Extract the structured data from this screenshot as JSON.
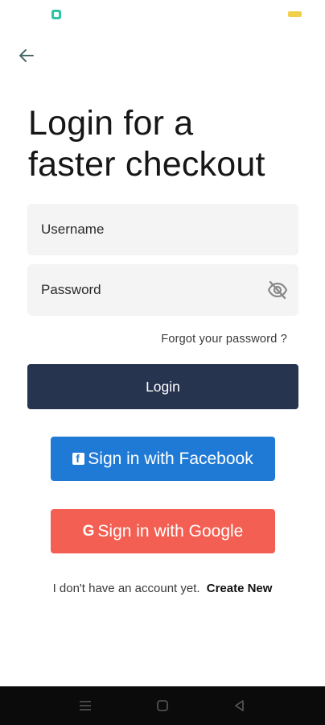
{
  "status_bar": {
    "left_icon": "app-notification-icon",
    "battery_color": "#f2cf4b"
  },
  "header": {
    "back_icon": "back-arrow-icon"
  },
  "title": {
    "line1": "Login for a",
    "line2": "faster checkout"
  },
  "form": {
    "username": {
      "placeholder": "Username",
      "value": ""
    },
    "password": {
      "placeholder": "Password",
      "value": "",
      "toggle_icon": "eye-off-icon"
    },
    "forgot_label": "Forgot your password ?",
    "login_label": "Login"
  },
  "social": {
    "facebook_label": "Sign in with Facebook",
    "google_label": "Sign in with Google"
  },
  "signup": {
    "prompt": "I don't have an account yet.",
    "link_label": "Create New"
  },
  "colors": {
    "primary": "#27344f",
    "facebook": "#1f7ad6",
    "google": "#f35f52",
    "field_bg": "#f4f4f4"
  },
  "nav_bar": {
    "items": [
      "menu-icon",
      "home-icon",
      "back-triangle-icon"
    ]
  }
}
